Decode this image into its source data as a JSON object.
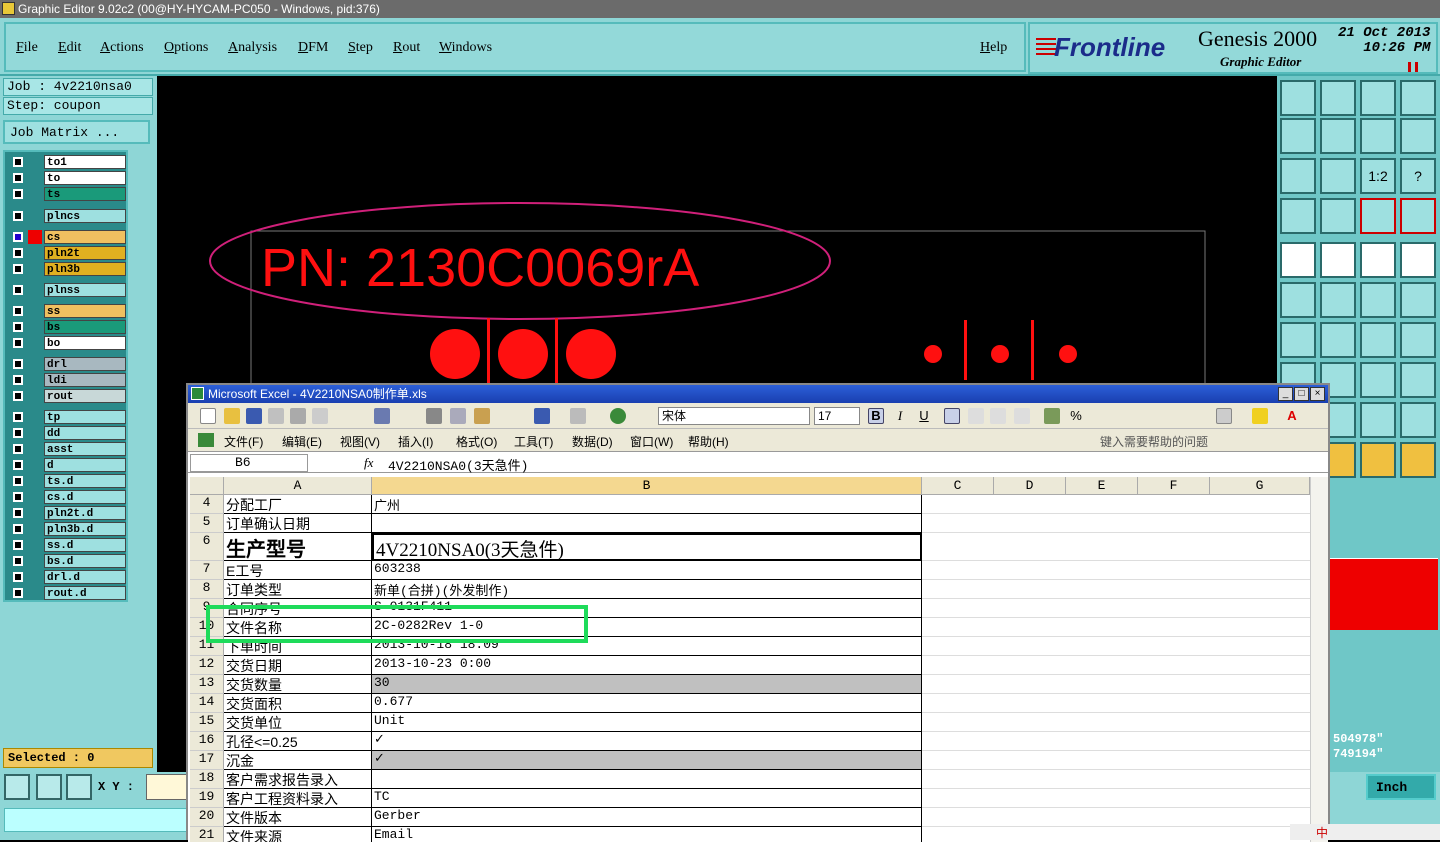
{
  "window": {
    "title": "Graphic Editor 9.02c2 (00@HY-HYCAM-PC050 - Windows, pid:376)"
  },
  "menu": {
    "items": [
      "File",
      "Edit",
      "Actions",
      "Options",
      "Analysis",
      "DFM",
      "Step",
      "Rout",
      "Windows"
    ],
    "help": "Help"
  },
  "brand": {
    "logo": "Frontline",
    "product": "Genesis 2000",
    "sub": "Graphic Editor",
    "date": "21 Oct 2013",
    "time": "10:26 PM"
  },
  "job": {
    "job": "Job : 4v2210nsa0",
    "step": "Step: coupon",
    "matrix": "Job Matrix ..."
  },
  "layers": [
    {
      "name": "to1",
      "color": "#ffffff"
    },
    {
      "name": "to",
      "color": "#ffffff"
    },
    {
      "name": "ts",
      "color": "#1a9a7a"
    },
    {
      "name": "plncs",
      "color": "#9ee0e0"
    },
    {
      "name": "cs",
      "color": "#f0c060"
    },
    {
      "name": "pln2t",
      "color": "#e0b020"
    },
    {
      "name": "pln3b",
      "color": "#e0b020"
    },
    {
      "name": "plnss",
      "color": "#9ee0e0"
    },
    {
      "name": "ss",
      "color": "#f0c060"
    },
    {
      "name": "bs",
      "color": "#1a9a7a"
    },
    {
      "name": "bo",
      "color": "#ffffff"
    },
    {
      "name": "drl",
      "color": "#a8b8c0"
    },
    {
      "name": "ldi",
      "color": "#a8b8c0"
    },
    {
      "name": "rout",
      "color": "#c8d8d8"
    },
    {
      "name": "tp",
      "color": "#9ee0e0"
    },
    {
      "name": "dd",
      "color": "#9ee0e0"
    },
    {
      "name": "asst",
      "color": "#9ee0e0"
    },
    {
      "name": "d",
      "color": "#9ee0e0"
    },
    {
      "name": "ts.d",
      "color": "#9ee0e0"
    },
    {
      "name": "cs.d",
      "color": "#9ee0e0"
    },
    {
      "name": "pln2t.d",
      "color": "#9ee0e0"
    },
    {
      "name": "pln3b.d",
      "color": "#9ee0e0"
    },
    {
      "name": "ss.d",
      "color": "#9ee0e0"
    },
    {
      "name": "bs.d",
      "color": "#9ee0e0"
    },
    {
      "name": "drl.d",
      "color": "#9ee0e0"
    },
    {
      "name": "rout.d",
      "color": "#9ee0e0"
    }
  ],
  "selected": "Selected : 0",
  "xy_label": "X Y :",
  "canvas": {
    "pn_text": "PN: 2130C0069rA"
  },
  "coords": {
    "x": "504978\"",
    "y": "749194\""
  },
  "units": "Inch",
  "toolbar_labels": {
    "ratio": "1:2",
    "help": "?"
  },
  "excel": {
    "title": "Microsoft Excel - 4V2210NSA0制作单.xls",
    "font": "宋体",
    "size": "17",
    "menu": [
      "文件(F)",
      "编辑(E)",
      "视图(V)",
      "插入(I)",
      "格式(O)",
      "工具(T)",
      "数据(D)",
      "窗口(W)",
      "帮助(H)"
    ],
    "help_placeholder": "键入需要帮助的问题",
    "cell_ref": "B6",
    "fx": "fx",
    "formula": "4V2210NSA0(3天急件)",
    "columns": [
      "A",
      "B",
      "C",
      "D",
      "E",
      "F",
      "G"
    ],
    "rows": [
      {
        "n": "4",
        "a": "分配工厂",
        "b": "广州"
      },
      {
        "n": "5",
        "a": "订单确认日期",
        "b": ""
      },
      {
        "n": "6",
        "a": "生产型号",
        "b": "4V2210NSA0(3天急件)"
      },
      {
        "n": "7",
        "a": "E工号",
        "b": "603238"
      },
      {
        "n": "8",
        "a": "订单类型",
        "b": "新单(合拼)(外发制作)"
      },
      {
        "n": "9",
        "a": "合同序号",
        "b": "S-0131F411"
      },
      {
        "n": "10",
        "a": "文件名称",
        "b": "2C-0282Rev 1-0"
      },
      {
        "n": "11",
        "a": "下单时间",
        "b": "2013-10-18 18:09"
      },
      {
        "n": "12",
        "a": "交货日期",
        "b": "2013-10-23 0:00"
      },
      {
        "n": "13",
        "a": "交货数量",
        "b": "30"
      },
      {
        "n": "14",
        "a": "交货面积",
        "b": "0.677"
      },
      {
        "n": "15",
        "a": "交货单位",
        "b": "Unit"
      },
      {
        "n": "16",
        "a": "孔径<=0.25",
        "b": "✓"
      },
      {
        "n": "17",
        "a": "沉金",
        "b": "✓"
      },
      {
        "n": "18",
        "a": "客户需求报告录入",
        "b": ""
      },
      {
        "n": "19",
        "a": "客户工程资料录入",
        "b": "TC"
      },
      {
        "n": "20",
        "a": "文件版本",
        "b": "Gerber"
      },
      {
        "n": "21",
        "a": "文件来源",
        "b": "Email"
      }
    ]
  },
  "ime": {
    "label": "中"
  }
}
